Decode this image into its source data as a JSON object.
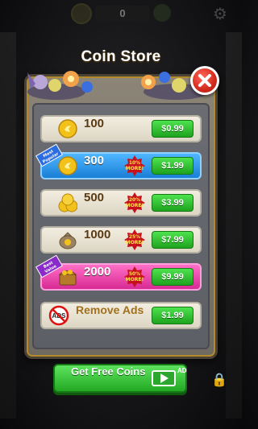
{
  "topbar": {
    "coin_count": "0"
  },
  "store": {
    "title": "Coin Store",
    "rows": [
      {
        "amount": "100",
        "price": "$0.99"
      },
      {
        "amount": "300",
        "price": "$1.99",
        "bonus": "10% MORE!",
        "ribbon": "Most Popular"
      },
      {
        "amount": "500",
        "price": "$3.99",
        "bonus": "20% MORE!"
      },
      {
        "amount": "1000",
        "price": "$7.99",
        "bonus": "25% MORE!"
      },
      {
        "amount": "2000",
        "price": "$9.99",
        "bonus": "50% MORE!",
        "ribbon": "Best Value"
      }
    ],
    "remove_ads": {
      "label": "Remove Ads",
      "price": "$1.99",
      "icon_text": "ADS"
    }
  },
  "free_coins": {
    "label": "Get Free Coins",
    "ad_tag": "AD"
  },
  "icons": {
    "close": "close-icon",
    "coin": "coin-icon",
    "settings": "gear-icon",
    "video": "video-play-icon",
    "no_ads": "no-ads-icon"
  },
  "colors": {
    "price_button": "#23a823",
    "popular_row": "#1a7fd6",
    "best_value_row": "#d72a94",
    "close_button": "#d22a1c"
  }
}
